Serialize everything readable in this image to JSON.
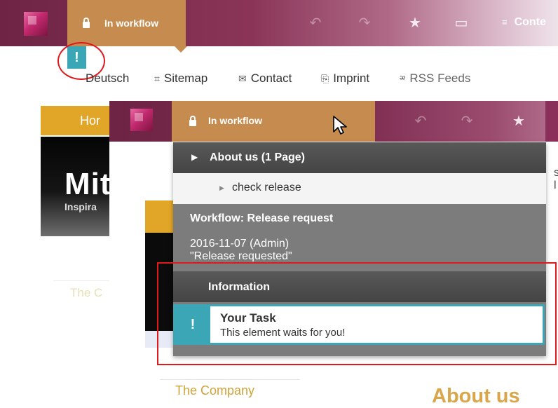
{
  "background": {
    "toolbar": {
      "workflow_tab": "In workflow",
      "icons": [
        "undo-icon",
        "redo-icon",
        "star-add-icon",
        "device-preview-icon",
        "content-icon"
      ],
      "content_label": "Conte"
    },
    "warning_badge": "!",
    "nav": {
      "items": [
        {
          "label": "Deutsch",
          "icon": "flag-icon"
        },
        {
          "label": "Sitemap",
          "icon": "sitemap-icon"
        },
        {
          "label": "Contact",
          "icon": "mail-icon"
        },
        {
          "label": "Imprint",
          "icon": "imprint-icon"
        },
        {
          "label": "RSS Feeds",
          "icon": "rss-icon"
        }
      ]
    },
    "page": {
      "home_tab": "Hor",
      "banner_title": "Mit",
      "banner_subtitle": "Inspira",
      "company_link": "The C"
    }
  },
  "foreground": {
    "toolbar": {
      "workflow_tab": "In workflow"
    },
    "dropdown": {
      "page_header": "About us (1 Page)",
      "task_item": "check release",
      "workflow_title": "Workflow: Release request",
      "workflow_date": "2016-11-07 (Admin)",
      "workflow_status": "\"Release requested\"",
      "info_header": "Information",
      "task_badge": "!",
      "task_title": "Your Task",
      "task_message": "This element waits for you!"
    },
    "page": {
      "company_link": "The Company",
      "heading": "About us",
      "edge_letter": "s l"
    }
  },
  "colors": {
    "toolbar": "#6e2445",
    "workflow_tab": "#c58b4f",
    "badge": "#3aa6b6",
    "highlight": "#e0191d",
    "accent_orange": "#e1a628"
  }
}
